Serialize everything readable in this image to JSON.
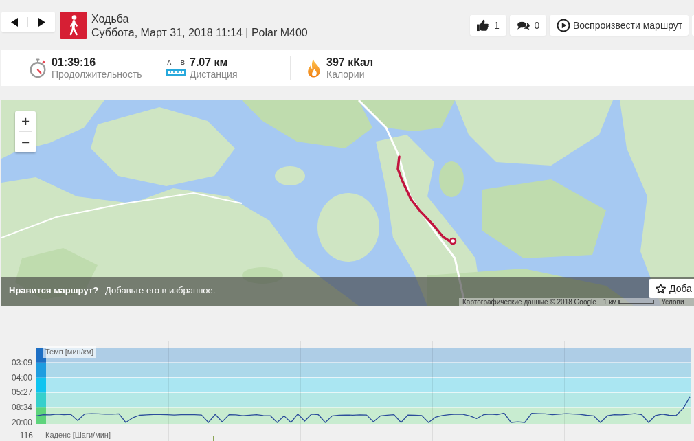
{
  "activity": {
    "title": "Ходьба",
    "subtitle": "Суббота, Март 31, 2018 11:14 | Polar M400"
  },
  "actions": [
    {
      "kind": "like",
      "label": "1"
    },
    {
      "kind": "comments",
      "label": "0"
    },
    {
      "kind": "play",
      "label": "Воспроизвести маршрут"
    }
  ],
  "summary": [
    {
      "kind": "duration",
      "value": "01:39:16",
      "label": "Продолжительность"
    },
    {
      "kind": "distance",
      "value": "7.07 км",
      "label": "Дистанция",
      "icon_marks": [
        "A",
        "B"
      ]
    },
    {
      "kind": "calories",
      "value": "397 кКал",
      "label": "Калории"
    }
  ],
  "map": {
    "zoom_controls": [
      "+",
      "−"
    ],
    "prompt": {
      "question": "Нравится маршрут?",
      "text": "Добавьте его в избранное."
    },
    "favorite_button": "Доба",
    "attribution": "Картографические данные © 2018 Google",
    "scale": "1 км",
    "terms": "Услови"
  },
  "pace_chart": {
    "title": "Темп [мин/км]",
    "y_labels": [
      "03:09",
      "04:00",
      "05:27",
      "08:34",
      "20:00"
    ]
  },
  "cadence_chart": {
    "title": "Каденс [Шаги/мин]",
    "y_labels": [
      "116"
    ]
  }
}
